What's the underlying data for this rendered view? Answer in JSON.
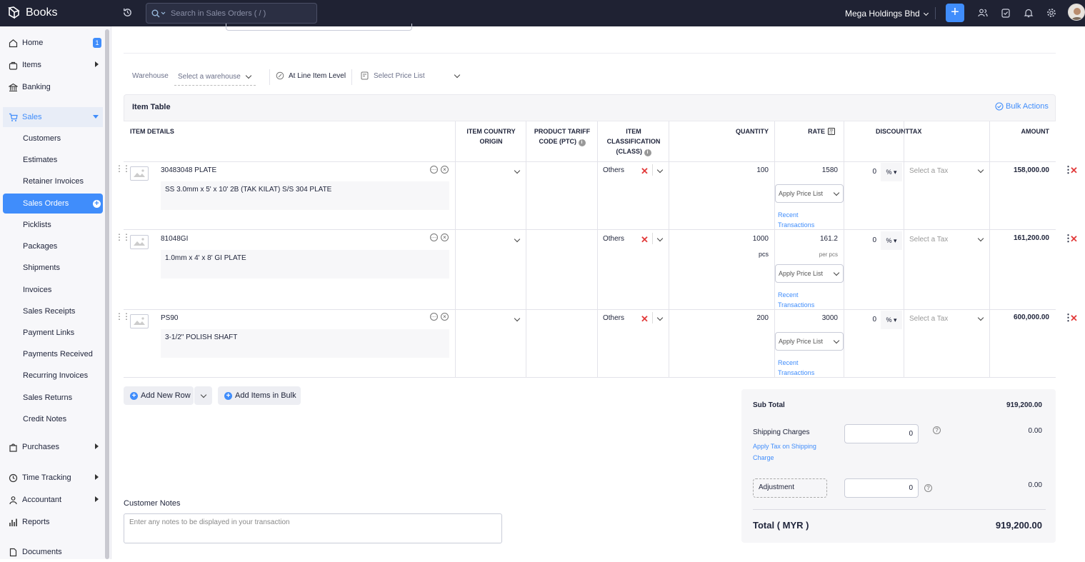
{
  "app": {
    "name": "Books"
  },
  "search": {
    "placeholder": "Search in Sales Orders ( / )"
  },
  "org": {
    "name": "Mega Holdings Bhd"
  },
  "sidebar": {
    "home": {
      "label": "Home",
      "badge": "1"
    },
    "items": {
      "label": "Items"
    },
    "banking": {
      "label": "Banking"
    },
    "sales": {
      "label": "Sales"
    },
    "sub": [
      "Customers",
      "Estimates",
      "Retainer Invoices",
      "Sales Orders",
      "Picklists",
      "Packages",
      "Shipments",
      "Invoices",
      "Sales Receipts",
      "Payment Links",
      "Payments Received",
      "Recurring Invoices",
      "Sales Returns",
      "Credit Notes"
    ],
    "purchases": {
      "label": "Purchases"
    },
    "time": {
      "label": "Time Tracking"
    },
    "accountant": {
      "label": "Accountant"
    },
    "reports": {
      "label": "Reports"
    },
    "documents": {
      "label": "Documents"
    }
  },
  "toolbar": {
    "warehouse_label": "Warehouse",
    "warehouse_placeholder": "Select a warehouse",
    "discount_level": "At Line Item Level",
    "price_list_placeholder": "Select Price List"
  },
  "item_table": {
    "title": "Item Table",
    "bulk_actions": "Bulk Actions",
    "headers": {
      "item_details": "ITEM DETAILS",
      "country_1": "ITEM COUNTRY",
      "country_2": "ORIGIN",
      "tariff_1": "PRODUCT TARIFF",
      "tariff_2": "CODE (PTC)",
      "class_1": "ITEM",
      "class_2": "CLASSIFICATION",
      "class_3": "(CLASS)",
      "quantity": "QUANTITY",
      "rate": "RATE",
      "discount": "DISCOUNT",
      "tax": "TAX",
      "amount": "AMOUNT"
    },
    "rows": [
      {
        "name": "30483048 PLATE",
        "description": "SS 3.0mm x 5' x 10' 2B (TAK KILAT) S/S 304 PLATE",
        "classification": "Others",
        "quantity": "100",
        "unit": "",
        "rate": "1580",
        "rate_unit": "",
        "discount": "0",
        "discount_type": "%",
        "tax": "Select a Tax",
        "amount": "158,000.00",
        "apply_price": "Apply Price List",
        "recent_1": "Recent",
        "recent_2": "Transactions"
      },
      {
        "name": "81048GI",
        "description": "1.0mm x 4' x 8' GI PLATE",
        "classification": "Others",
        "quantity": "1000",
        "unit": "pcs",
        "rate": "161.2",
        "rate_unit": "per pcs",
        "discount": "0",
        "discount_type": "%",
        "tax": "Select a Tax",
        "amount": "161,200.00",
        "apply_price": "Apply Price List",
        "recent_1": "Recent",
        "recent_2": "Transactions"
      },
      {
        "name": "PS90",
        "description": "3-1/2\" POLISH SHAFT",
        "classification": "Others",
        "quantity": "200",
        "unit": "",
        "rate": "3000",
        "rate_unit": "",
        "discount": "0",
        "discount_type": "%",
        "tax": "Select a Tax",
        "amount": "600,000.00",
        "apply_price": "Apply Price List",
        "recent_1": "Recent",
        "recent_2": "Transactions"
      }
    ]
  },
  "actions": {
    "add_row": "Add New Row",
    "add_bulk": "Add Items in Bulk"
  },
  "totals": {
    "sub_total_label": "Sub Total",
    "sub_total": "919,200.00",
    "shipping_label": "Shipping Charges",
    "shipping_value": "0",
    "shipping_amount": "0.00",
    "apply_tax_1": "Apply Tax on Shipping",
    "apply_tax_2": "Charge",
    "adjustment_label": "Adjustment",
    "adjustment_value": "0",
    "adjustment_amount": "0.00",
    "total_label": "Total ( MYR )",
    "total": "919,200.00"
  },
  "notes": {
    "label": "Customer Notes",
    "placeholder": "Enter any notes to be displayed in your transaction"
  },
  "colors": {
    "accent": "#408dfb",
    "topbar": "#1f2233",
    "danger": "#e23b3b"
  }
}
